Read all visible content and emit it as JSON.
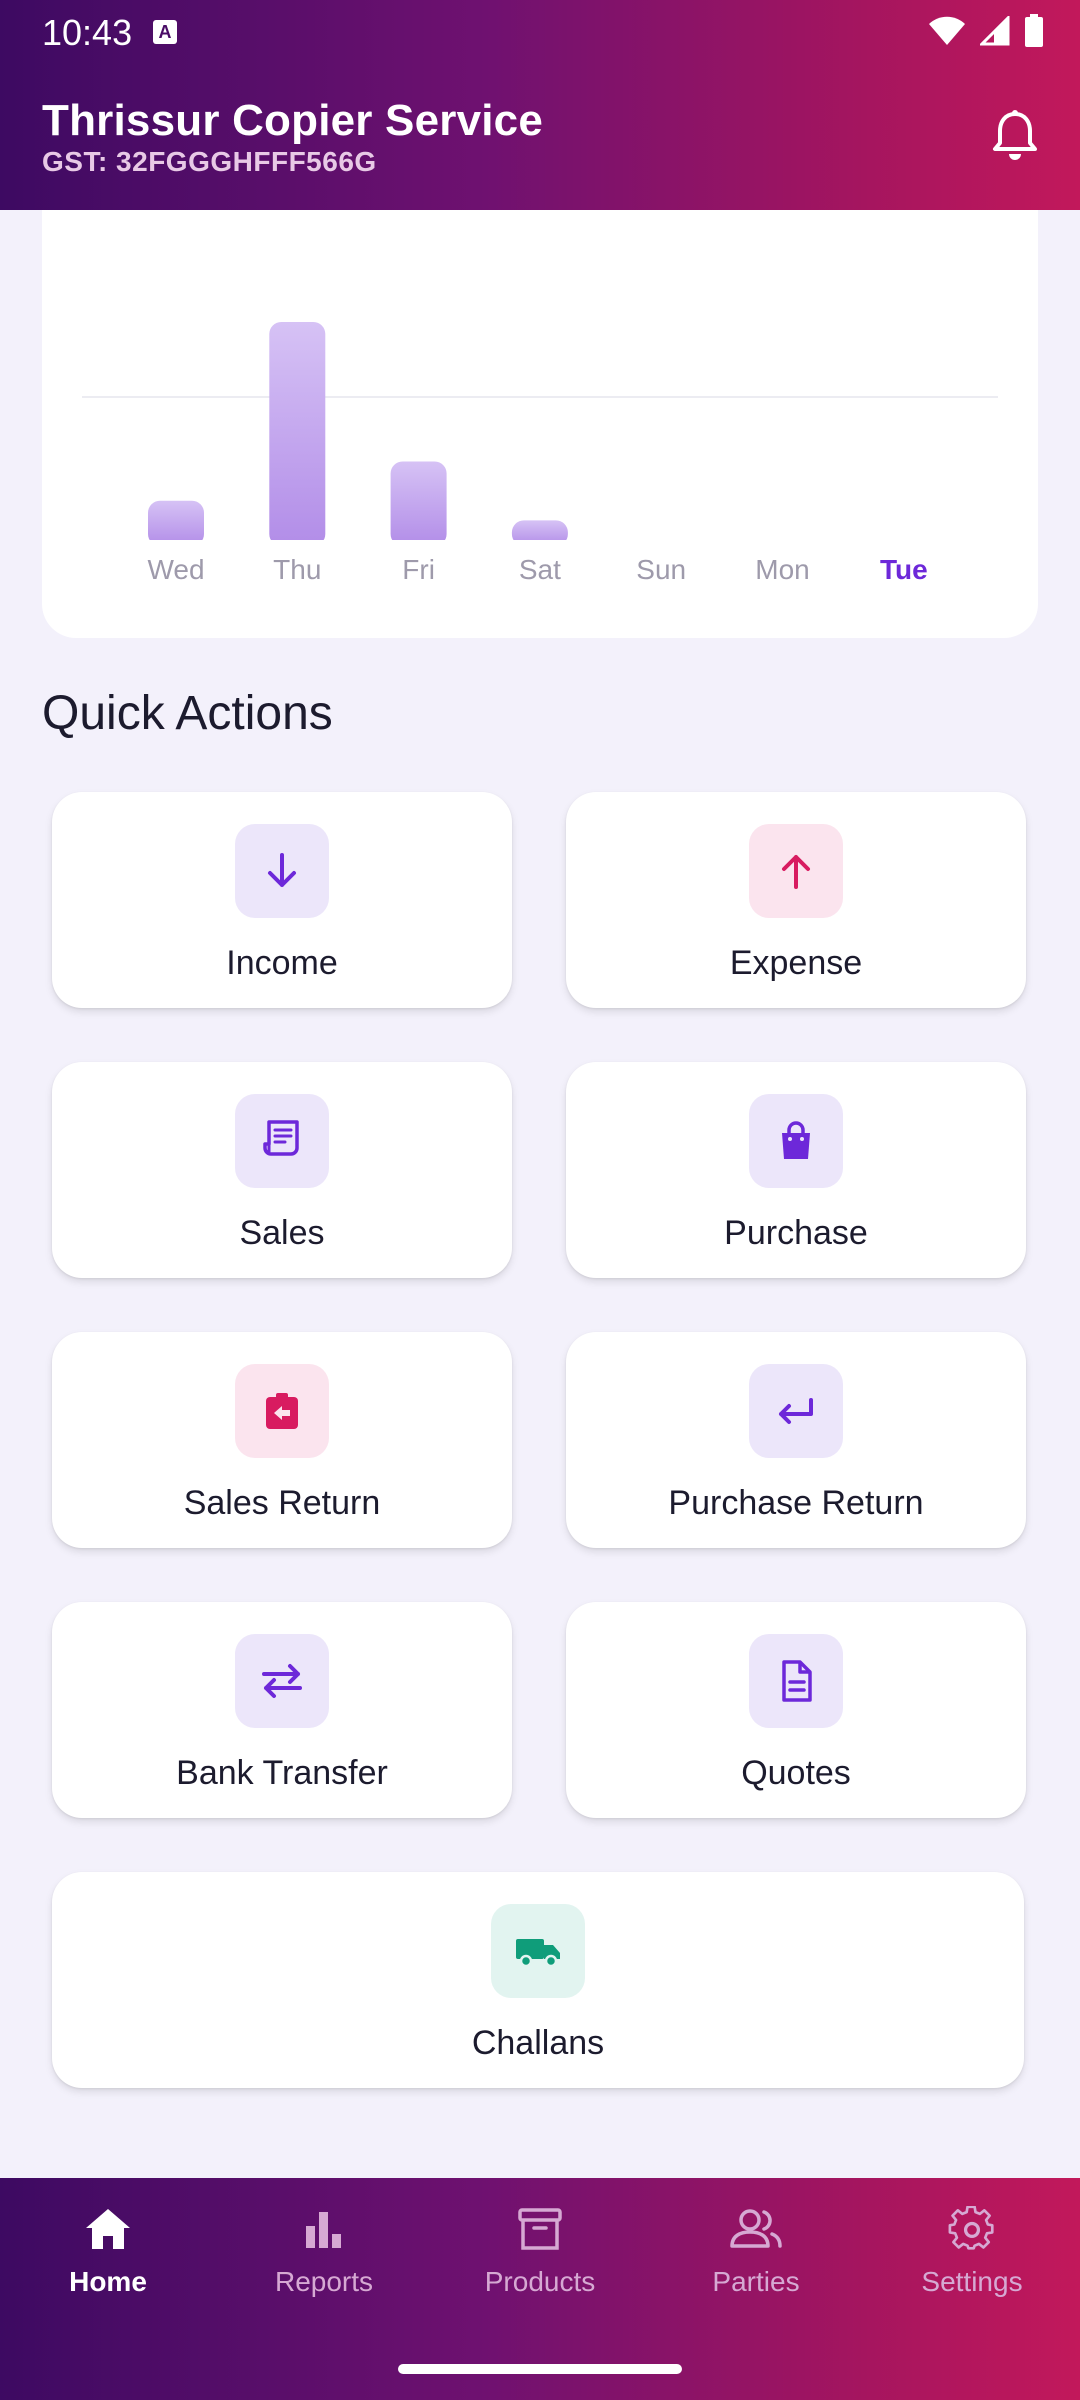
{
  "status_bar": {
    "time": "10:43",
    "badge": "A"
  },
  "header": {
    "title": "Thrissur Copier Service",
    "subtitle": "GST: 32FGGGHFFF566G"
  },
  "chart_data": {
    "type": "bar",
    "categories": [
      "Wed",
      "Thu",
      "Fri",
      "Sat",
      "Sun",
      "Mon",
      "Tue"
    ],
    "values": [
      18,
      100,
      36,
      9,
      0,
      0,
      0
    ],
    "highlighted_category": "Tue",
    "grid": true,
    "colors": {
      "bar_top": "#d6c2f5",
      "bar_bottom": "#b28de8",
      "label": "#9e9aab",
      "highlight_label": "#6d28d9",
      "grid": "#ececf2"
    }
  },
  "quick_actions": {
    "title": "Quick Actions",
    "items": [
      {
        "label": "Income",
        "icon": "arrow-down-icon"
      },
      {
        "label": "Expense",
        "icon": "arrow-up-icon"
      },
      {
        "label": "Sales",
        "icon": "receipt-icon"
      },
      {
        "label": "Purchase",
        "icon": "shopping-bag-icon"
      },
      {
        "label": "Sales Return",
        "icon": "return-clipboard-icon"
      },
      {
        "label": "Purchase Return",
        "icon": "return-arrow-icon"
      },
      {
        "label": "Bank Transfer",
        "icon": "transfer-arrows-icon"
      },
      {
        "label": "Quotes",
        "icon": "document-icon"
      },
      {
        "label": "Challans",
        "icon": "truck-icon"
      }
    ]
  },
  "bottom_nav": {
    "items": [
      {
        "label": "Home",
        "icon": "home-icon",
        "active": true
      },
      {
        "label": "Reports",
        "icon": "bar-chart-icon",
        "active": false
      },
      {
        "label": "Products",
        "icon": "archive-box-icon",
        "active": false
      },
      {
        "label": "Parties",
        "icon": "users-icon",
        "active": false
      },
      {
        "label": "Settings",
        "icon": "gear-icon",
        "active": false
      }
    ]
  },
  "theme": {
    "purple": "#6d28d9",
    "pink": "#d81b60",
    "teal": "#0f9d7a",
    "gradient_start": "#3d0a62",
    "gradient_end": "#c2185b"
  }
}
